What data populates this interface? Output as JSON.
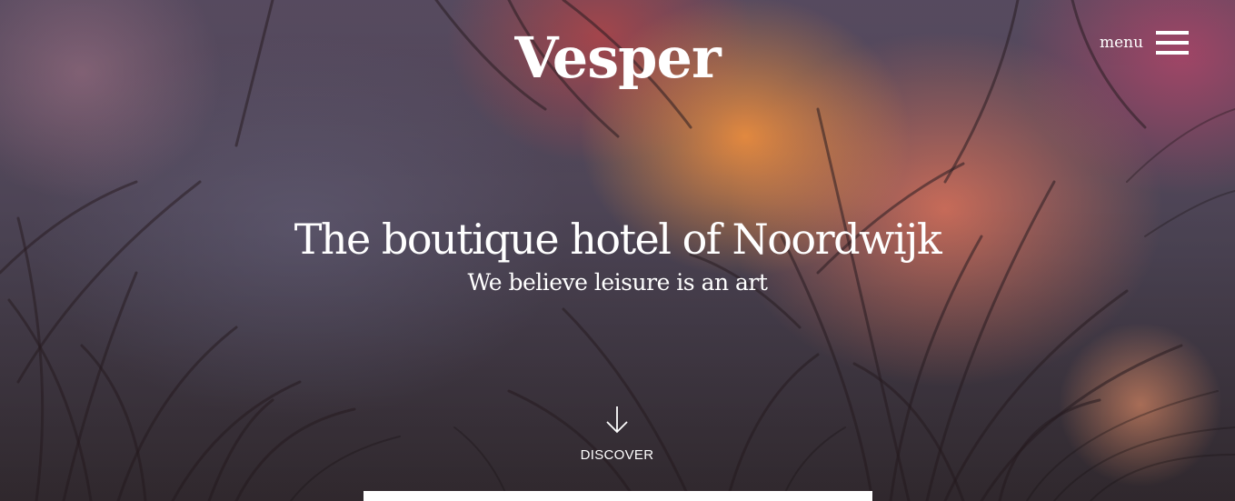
{
  "brand": {
    "logo_text": "Vesper"
  },
  "header": {
    "menu_label": "menu"
  },
  "hero": {
    "headline": "The boutique hotel of Noordwijk",
    "subheadline": "We believe leisure is an art",
    "discover_label": "DISCOVER",
    "background_image": "blurred pine needles at sunset",
    "colors": {
      "text": "#ffffff",
      "sunset_orange": "#f0923c",
      "sunset_pink": "#d0607a",
      "dusk_purple": "#4a4252"
    }
  },
  "icons": {
    "menu": "hamburger-icon",
    "discover": "arrow-down-icon"
  }
}
